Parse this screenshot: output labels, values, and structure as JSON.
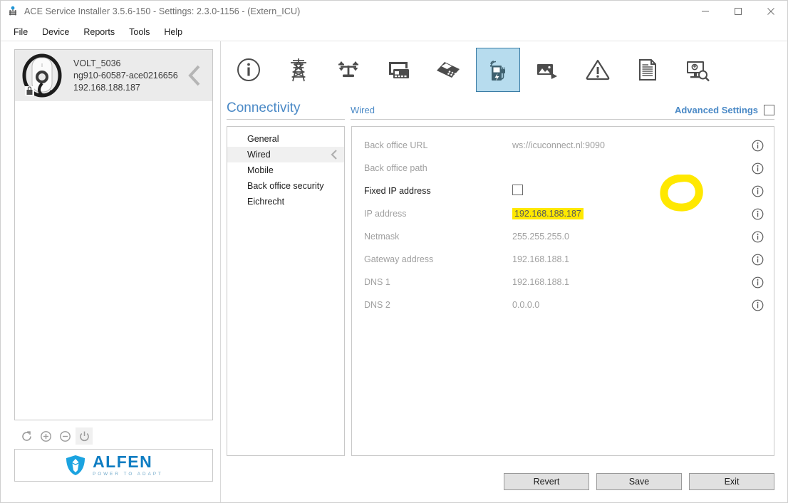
{
  "window": {
    "title": "ACE Service Installer 3.5.6-150 - Settings: 2.3.0-1156 -  (Extern_ICU)",
    "app_icon": "ace-app-icon",
    "minimize": "minimize-icon",
    "maximize": "maximize-icon",
    "close": "close-icon"
  },
  "menu": {
    "items": [
      {
        "label": "File"
      },
      {
        "label": "Device"
      },
      {
        "label": "Reports"
      },
      {
        "label": "Tools"
      },
      {
        "label": "Help"
      }
    ]
  },
  "sidebar": {
    "device": {
      "name": "VOLT_5036",
      "serial": "ng910-60587-ace0216656",
      "ip": "192.168.188.187",
      "thumb_icon": "ev-wallbox-charger-icon",
      "lock_icon": "padlock-icon",
      "collapse_icon": "chevron-left-icon"
    },
    "actions": [
      {
        "icon": "refresh-icon",
        "name": "refresh-devices-button",
        "active": false
      },
      {
        "icon": "plus-circle-icon",
        "name": "add-device-button",
        "active": false
      },
      {
        "icon": "minus-circle-icon",
        "name": "remove-device-button",
        "active": false
      },
      {
        "icon": "power-icon",
        "name": "power-button",
        "active": true
      }
    ],
    "logo": {
      "word": "ALFEN",
      "tagline": "POWER TO ADAPT",
      "shield_icon": "alfen-shield-logo"
    }
  },
  "toolbar": {
    "tabs": [
      {
        "name": "tab-info",
        "icon": "info-circle-icon",
        "selected": false
      },
      {
        "name": "tab-grid",
        "icon": "power-pylon-icon",
        "selected": false
      },
      {
        "name": "tab-load-balancing",
        "icon": "balance-scale-icon",
        "selected": false
      },
      {
        "name": "tab-card-reader",
        "icon": "card-reader-icon",
        "selected": false
      },
      {
        "name": "tab-payment-terminal",
        "icon": "payment-terminal-icon",
        "selected": false
      },
      {
        "name": "tab-connectivity",
        "icon": "ev-charger-wifi-icon",
        "selected": true
      },
      {
        "name": "tab-display",
        "icon": "image-display-icon",
        "selected": false
      },
      {
        "name": "tab-alarms",
        "icon": "warning-triangle-icon",
        "selected": false
      },
      {
        "name": "tab-logs",
        "icon": "document-icon",
        "selected": false
      },
      {
        "name": "tab-diagnostics",
        "icon": "monitor-search-icon",
        "selected": false
      }
    ]
  },
  "content": {
    "section_title": "Connectivity",
    "page_title": "Wired",
    "advanced_settings": {
      "label": "Advanced Settings",
      "checked": false
    },
    "nav": {
      "items": [
        {
          "label": "General",
          "selected": false
        },
        {
          "label": "Wired",
          "selected": true
        },
        {
          "label": "Mobile",
          "selected": false
        },
        {
          "label": "Back office security",
          "selected": false
        },
        {
          "label": "Eichrecht",
          "selected": false
        }
      ],
      "selected_chevron": "chevron-left-icon"
    },
    "fields": [
      {
        "label": "Back office URL",
        "value": "ws://icuconnect.nl:9090",
        "enabled": false,
        "type": "text",
        "info_icon": "info-circle-icon"
      },
      {
        "label": "Back office path",
        "value": "",
        "enabled": false,
        "type": "text",
        "info_icon": "info-circle-icon"
      },
      {
        "label": "Fixed IP address",
        "value": "",
        "enabled": true,
        "type": "checkbox",
        "checked": false,
        "annotated": true,
        "info_icon": "info-circle-icon"
      },
      {
        "label": "IP address",
        "value": "192.168.188.187",
        "enabled": false,
        "type": "text",
        "highlighted": true,
        "info_icon": "info-circle-icon"
      },
      {
        "label": "Netmask",
        "value": "255.255.255.0",
        "enabled": false,
        "type": "text",
        "info_icon": "info-circle-icon"
      },
      {
        "label": "Gateway address",
        "value": "192.168.188.1",
        "enabled": false,
        "type": "text",
        "info_icon": "info-circle-icon"
      },
      {
        "label": "DNS 1",
        "value": "192.168.188.1",
        "enabled": false,
        "type": "text",
        "info_icon": "info-circle-icon"
      },
      {
        "label": "DNS 2",
        "value": "0.0.0.0",
        "enabled": false,
        "type": "text",
        "info_icon": "info-circle-icon"
      }
    ]
  },
  "footer": {
    "buttons": [
      {
        "label": "Revert",
        "name": "revert-button"
      },
      {
        "label": "Save",
        "name": "save-button"
      },
      {
        "label": "Exit",
        "name": "exit-button"
      }
    ]
  },
  "annotation": {
    "highlight_color": "#ffe800",
    "circle_target": "fixed-ip-address-checkbox",
    "highlight_target": "ip-address-value"
  },
  "colors": {
    "accent_blue": "#4a89c6",
    "selected_tab_bg": "#b7dcee",
    "selected_tab_border": "#3a7ca5",
    "highlight_yellow": "#ffe800"
  }
}
